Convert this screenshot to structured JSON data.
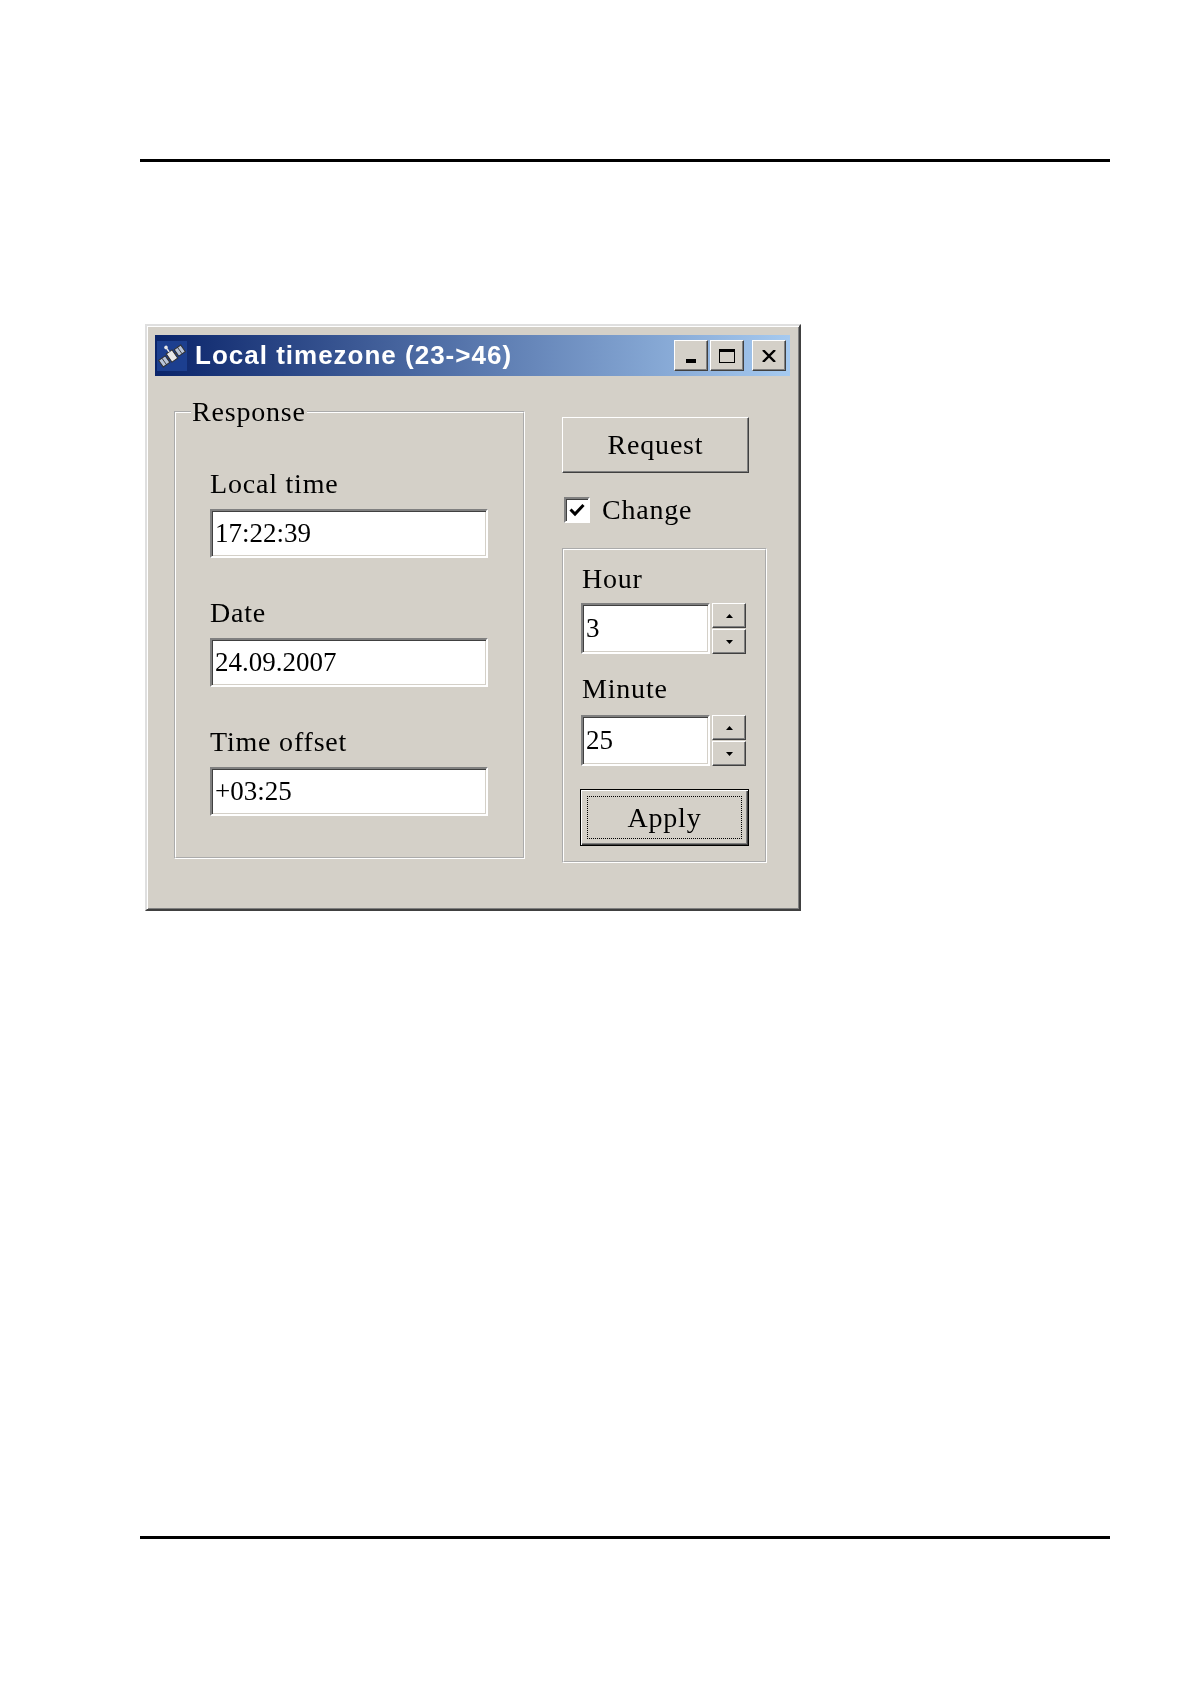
{
  "window": {
    "title": "Local timezone (23->46)"
  },
  "response": {
    "title": "Response",
    "fields": [
      {
        "label": "Local time",
        "value": "17:22:39"
      },
      {
        "label": "Date",
        "value": "24.09.2007"
      },
      {
        "label": "Time offset",
        "value": "+03:25"
      }
    ]
  },
  "request_button": {
    "label": "Request"
  },
  "change": {
    "label": "Change",
    "checked": true
  },
  "adjust": {
    "spinners": [
      {
        "label": "Hour",
        "value": "3"
      },
      {
        "label": "Minute",
        "value": "25"
      }
    ],
    "apply_button": {
      "label": "Apply",
      "focused": true
    }
  }
}
